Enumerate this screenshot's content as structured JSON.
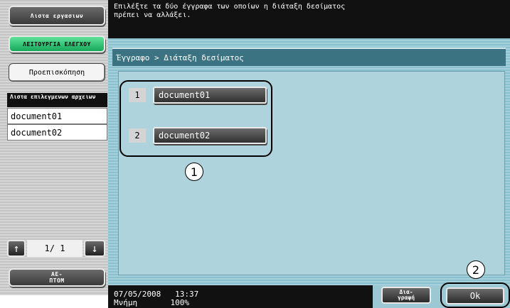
{
  "sidebar": {
    "job_list_label": "Λιστα εργασιων",
    "check_mode_label": "ΛΕΙΤΟΥΡΓΙΑ ΕΛΕΓΧΟΥ",
    "preview_label": "Προεπισκόπηση",
    "selected_files_header": "Λιστα επιλεγμενων αρχειων",
    "selected_files": [
      "document01",
      "document02"
    ],
    "pager": {
      "up_icon": "arrow-up",
      "down_icon": "arrow-down",
      "page_text": "1/ 1"
    },
    "close_label": "ΑΕ-\nΠΤΟΜ"
  },
  "header": {
    "message": "Επιλέξτε τα δύο έγγραφα των οποίων η διάταξη δεσίματος\nπρέπει να αλλάξει."
  },
  "breadcrumb": "Έγγραφο > Διάταξη δεσίματος",
  "documents": [
    {
      "number": "1",
      "name": "document01"
    },
    {
      "number": "2",
      "name": "document02"
    }
  ],
  "callouts": {
    "first": "1",
    "second": "2"
  },
  "footer": {
    "datetime": "07/05/2008   13:37",
    "memory": "Μνήμη       100%",
    "delete_label": "Δια-\nγραφή",
    "ok_label": "Ok"
  }
}
